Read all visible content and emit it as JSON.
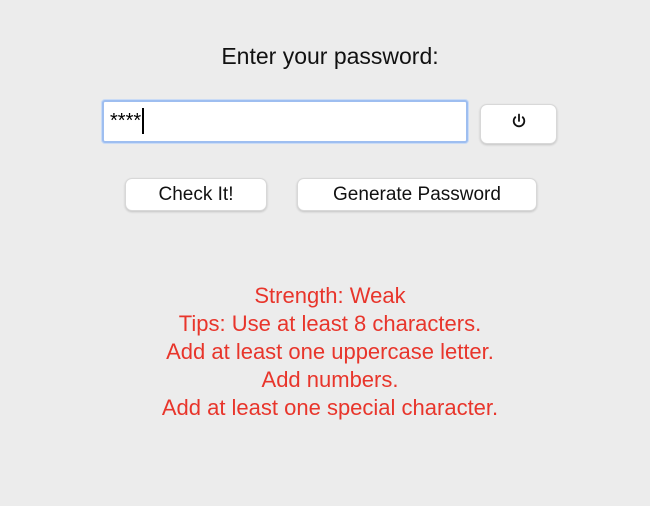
{
  "prompt": "Enter your password:",
  "password_input": {
    "masked_value": "****"
  },
  "toggle_button": {
    "icon": "power-icon"
  },
  "buttons": {
    "check": "Check It!",
    "generate": "Generate Password"
  },
  "feedback": {
    "color": "#e8352b",
    "strength": "Strength: Weak",
    "tips": [
      "Tips: Use at least 8 characters.",
      "Add at least one uppercase letter.",
      "Add numbers.",
      "Add at least one special character."
    ]
  }
}
